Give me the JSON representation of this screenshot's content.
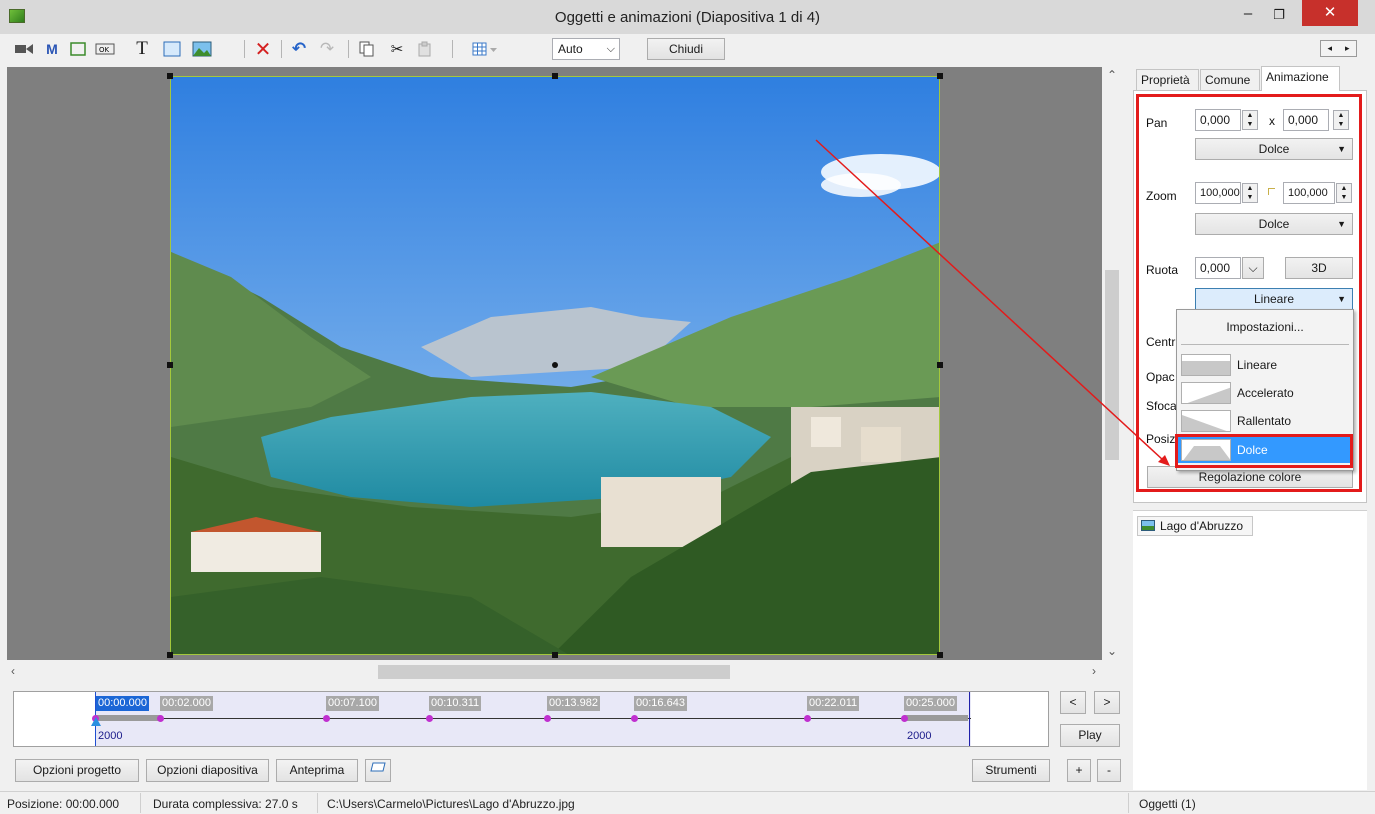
{
  "window": {
    "title": "Oggetti e animazioni  (Diapositiva 1 di 4)",
    "minimize": "–",
    "maximize": "❐",
    "close": "✕"
  },
  "toolbar": {
    "zoom_value": "Auto",
    "close_label": "Chiudi",
    "tools": [
      "camera-icon",
      "m-text-icon",
      "frame-icon",
      "ok-button-icon",
      "text-icon",
      "rectangle-icon",
      "image-icon",
      "delete-icon",
      "undo-icon",
      "redo-icon",
      "copy-icon",
      "cut-icon",
      "paste-icon",
      "grid-icon"
    ],
    "nav_left": "◂",
    "nav_right": "▸"
  },
  "canvas": {
    "image_alt": "Lago d'Abruzzo"
  },
  "timeline": {
    "markers": [
      "00:00.000",
      "00:02.000",
      "00:07.100",
      "00:10.311",
      "00:13.982",
      "00:16.643",
      "00:22.011",
      "00:25.000"
    ],
    "start_value": "2000",
    "end_value": "2000",
    "prev": "<",
    "next": ">",
    "play": "Play"
  },
  "bottom_buttons": {
    "project_options": "Opzioni progetto",
    "slide_options": "Opzioni diapositiva",
    "preview": "Anteprima",
    "tools": "Strumenti",
    "plus": "+",
    "minus": "-"
  },
  "status": {
    "position": "Posizione:  00:00.000",
    "duration": "Durata complessiva:  27.0 s",
    "path": "C:\\Users\\Carmelo\\Pictures\\Lago d'Abruzzo.jpg",
    "objects": "Oggetti (1)"
  },
  "panel": {
    "tabs": [
      "Proprietà",
      "Comune",
      "Animazione"
    ],
    "pan_label": "Pan",
    "pan_x": "0,000",
    "pan_x_sep": "x",
    "pan_y": "0,000",
    "pan_mode": "Dolce",
    "zoom_label": "Zoom",
    "zoom_x": "100,000",
    "zoom_y": "100,000",
    "zoom_mode": "Dolce",
    "rotate_label": "Ruota",
    "rotate_value": "0,000",
    "rotate_3d": "3D",
    "rotate_mode": "Lineare",
    "center_label": "Centr",
    "opacity_label": "Opac",
    "blur_label": "Sfoca",
    "position_label": "Posiz",
    "color_button": "Regolazione colore"
  },
  "menu": {
    "settings": "Impostazioni...",
    "items": [
      "Lineare",
      "Accelerato",
      "Rallentato",
      "Dolce"
    ],
    "selected": "Dolce"
  },
  "objects": {
    "item": "Lago d'Abruzzo"
  },
  "colors": {
    "highlight_red": "#e31b1b",
    "selection_blue": "#3399ff",
    "canvas_gray": "#7f7f7f"
  }
}
